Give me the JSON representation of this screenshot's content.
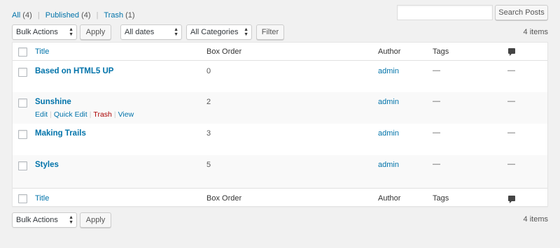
{
  "views": {
    "all_label": "All",
    "all_count": "(4)",
    "published_label": "Published",
    "published_count": "(4)",
    "trash_label": "Trash",
    "trash_count": "(1)",
    "separator": "|"
  },
  "search": {
    "placeholder": "",
    "button_label": "Search Posts"
  },
  "top_nav": {
    "bulk_actions": "Bulk Actions",
    "apply_label": "Apply",
    "date_filter": "All dates",
    "category_filter": "All Categories",
    "filter_label": "Filter",
    "items_count": "4 items"
  },
  "bottom_nav": {
    "bulk_actions": "Bulk Actions",
    "apply_label": "Apply",
    "items_count": "4 items"
  },
  "columns": {
    "title": "Title",
    "box_order": "Box Order",
    "author": "Author",
    "tags": "Tags"
  },
  "rows": [
    {
      "title": "Based on HTML5 UP",
      "box_order": "0",
      "author": "admin",
      "tags": "—",
      "comments": "—"
    },
    {
      "title": "Sunshine",
      "box_order": "2",
      "author": "admin",
      "tags": "—",
      "comments": "—"
    },
    {
      "title": "Making Trails",
      "box_order": "3",
      "author": "admin",
      "tags": "—",
      "comments": "—"
    },
    {
      "title": "Styles",
      "box_order": "5",
      "author": "admin",
      "tags": "—",
      "comments": "—"
    }
  ],
  "row_actions": {
    "edit": "Edit",
    "quick_edit": "Quick Edit",
    "trash": "Trash",
    "view": "View",
    "separator": "|"
  },
  "icons": {
    "comments_column": "speech-bubble-icon",
    "select_arrow": "up-down-arrows-icon"
  },
  "colors": {
    "link": "#0073aa",
    "trash_action": "#a00",
    "background": "#f1f1f1"
  }
}
